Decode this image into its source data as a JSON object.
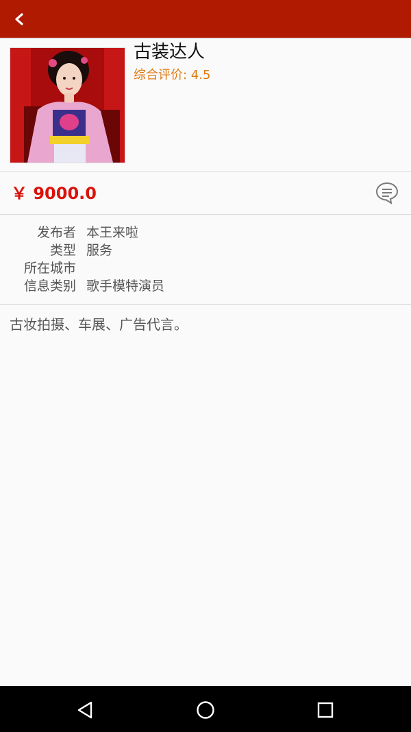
{
  "header": {
    "back_icon": "chevron-left-icon",
    "color": "#b01a00"
  },
  "item": {
    "title": "古装达人",
    "rating_text": "综合评价: 4.5",
    "price": "￥ 9000.0",
    "comment_icon": "comment-bubble-icon",
    "thumbnail_icon": "costume-photo"
  },
  "details": [
    {
      "label": "发布者",
      "value": "本王来啦"
    },
    {
      "label": "类型",
      "value": "服务"
    },
    {
      "label": "所在城市",
      "value": ""
    },
    {
      "label": "信息类别",
      "value": "歌手模特演员"
    }
  ],
  "description": "古妆拍摄、车展、广告代言。",
  "navbar": {
    "back": "nav-back-icon",
    "home": "nav-home-icon",
    "recents": "nav-recents-icon"
  },
  "colors": {
    "accent": "#b01a00",
    "price": "#d9130a",
    "rating": "#e07a12"
  }
}
